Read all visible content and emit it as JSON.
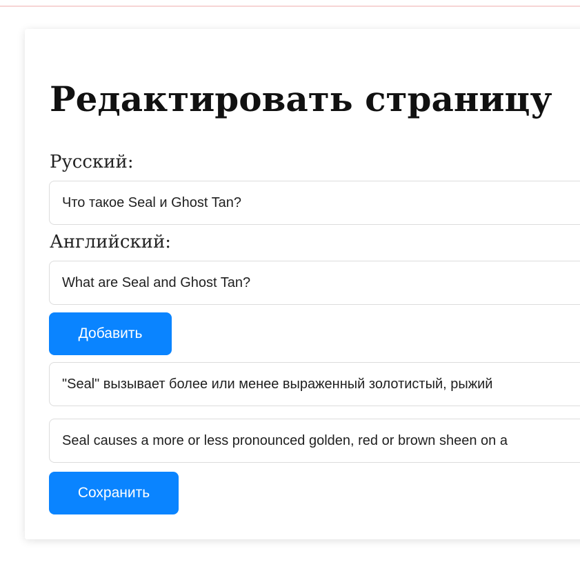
{
  "page": {
    "title": "Редактировать страницу"
  },
  "form": {
    "russian_label": "Русский:",
    "russian_value": "Что такое Seal и Ghost Tan?",
    "english_label": "Английский:",
    "english_value": "What are Seal and Ghost Tan?",
    "add_button_label": "Добавить",
    "answer_ru_value": "\"Seal\" вызывает более или менее выраженный золотистый, рыжий",
    "answer_en_value": "Seal causes a more or less pronounced golden, red or brown sheen on a",
    "save_button_label": "Сохранить"
  },
  "colors": {
    "accent": "#0a84ff",
    "text": "#111111",
    "border": "#dcdcdc"
  }
}
